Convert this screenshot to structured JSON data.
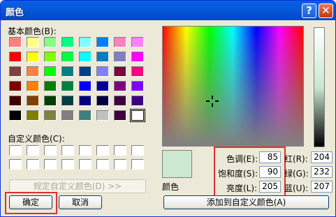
{
  "window": {
    "title": "颜色",
    "help_glyph": "?",
    "close_glyph": "✕"
  },
  "basic": {
    "label": "基本颜色(B):",
    "colors": [
      [
        "#ff8080",
        "#ffff80",
        "#80ff80",
        "#00ff80",
        "#80ffff",
        "#0080ff",
        "#ff80c0",
        "#ff80ff"
      ],
      [
        "#ff0000",
        "#ffff00",
        "#80ff00",
        "#00ff40",
        "#00ffff",
        "#0080c0",
        "#8080c0",
        "#ff00ff"
      ],
      [
        "#804040",
        "#ff8040",
        "#00ff00",
        "#008080",
        "#004080",
        "#8080ff",
        "#800040",
        "#ff0080"
      ],
      [
        "#800000",
        "#ff8000",
        "#008000",
        "#008040",
        "#0000ff",
        "#0000a0",
        "#800080",
        "#8000ff"
      ],
      [
        "#400000",
        "#804000",
        "#004000",
        "#004040",
        "#000080",
        "#000040",
        "#400040",
        "#400080"
      ],
      [
        "#000000",
        "#808000",
        "#808040",
        "#808080",
        "#408080",
        "#c0c0c0",
        "#400040",
        "#ffffff"
      ]
    ]
  },
  "custom": {
    "label": "自定义颜色(C):",
    "rows": 2,
    "cols": 8
  },
  "define_button": "规定自定义颜色(D) >>",
  "ok_button": "确定",
  "cancel_button": "取消",
  "preview_label": "颜色",
  "add_button": "添加到自定义颜色(A)",
  "hsl": [
    {
      "label": "色调(E):",
      "value": "85"
    },
    {
      "label": "饱和度(S):",
      "value": "90"
    },
    {
      "label": "亮度(L):",
      "value": "205"
    }
  ],
  "rgb": [
    {
      "label": "红(R):",
      "value": "204"
    },
    {
      "label": "绿(G):",
      "value": "232"
    },
    {
      "label": "蓝(U):",
      "value": "207"
    }
  ],
  "selected_color": "#cce8d0"
}
